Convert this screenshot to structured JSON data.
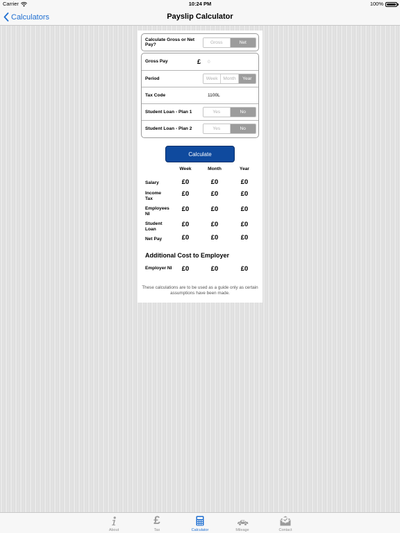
{
  "status_bar": {
    "carrier": "Carrier",
    "time": "10:24 PM",
    "battery": "100%"
  },
  "nav": {
    "back_label": "Calculators",
    "title": "Payslip Calculator"
  },
  "form": {
    "gross_or_net": {
      "label": "Calculate Gross or Net Pay?",
      "options": [
        "Gross",
        "Net"
      ],
      "selected": "Net"
    },
    "gross_pay": {
      "label": "Gross Pay",
      "currency": "£",
      "placeholder": "0"
    },
    "period": {
      "label": "Period",
      "options": [
        "Week",
        "Month",
        "Year"
      ],
      "selected": "Year"
    },
    "tax_code": {
      "label": "Tax Code",
      "value": "1100L"
    },
    "student_loan_plan1": {
      "label": "Student Loan - Plan 1",
      "options": [
        "Yes",
        "No"
      ],
      "selected": "No"
    },
    "student_loan_plan2": {
      "label": "Student Loan - Plan 2",
      "options": [
        "Yes",
        "No"
      ],
      "selected": "No"
    }
  },
  "calculate_label": "Calculate",
  "results": {
    "columns": [
      "Week",
      "Month",
      "Year"
    ],
    "rows": [
      {
        "label": "Salary",
        "values": [
          "£0",
          "£0",
          "£0"
        ]
      },
      {
        "label": "Income Tax",
        "values": [
          "£0",
          "£0",
          "£0"
        ]
      },
      {
        "label": "Employees NI",
        "values": [
          "£0",
          "£0",
          "£0"
        ]
      },
      {
        "label": "Student Loan",
        "values": [
          "£0",
          "£0",
          "£0"
        ]
      },
      {
        "label": "Net Pay",
        "values": [
          "£0",
          "£0",
          "£0"
        ]
      }
    ]
  },
  "additional": {
    "title": "Additional Cost to Employer",
    "rows": [
      {
        "label": "Employer NI",
        "values": [
          "£0",
          "£0",
          "£0"
        ]
      }
    ]
  },
  "disclaimer": "These calculations are to be used as a guide only as certain assumptions have been made.",
  "tabs": [
    {
      "label": "About",
      "icon": "info-icon"
    },
    {
      "label": "Tax",
      "icon": "pound-icon"
    },
    {
      "label": "Calculator",
      "icon": "calculator-icon",
      "active": true
    },
    {
      "label": "Mileage",
      "icon": "car-icon"
    },
    {
      "label": "Contact",
      "icon": "envelope-icon"
    }
  ],
  "colors": {
    "accent": "#1f6fd1",
    "button": "#0f4a9e",
    "segment_active": "#9c9c9c"
  }
}
